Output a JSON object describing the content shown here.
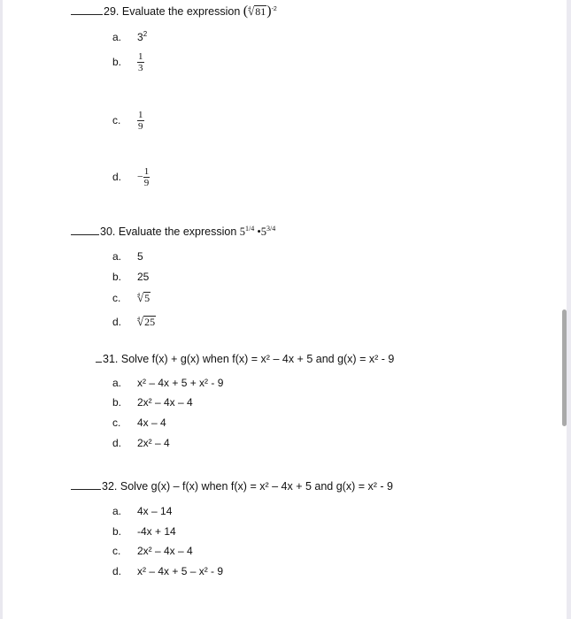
{
  "questions": [
    {
      "number": "29.",
      "prompt": "Evaluate the expression",
      "expression": {
        "root_index": "4",
        "radicand": "81",
        "exponent": "-2"
      },
      "choices": [
        {
          "letter": "a.",
          "base": "3",
          "exp": "2"
        },
        {
          "letter": "b.",
          "num": "1",
          "den": "3"
        },
        {
          "letter": "c.",
          "num": "1",
          "den": "9"
        },
        {
          "letter": "d.",
          "sign": "−",
          "num": "1",
          "den": "9"
        }
      ]
    },
    {
      "number": "30.",
      "prompt": "Evaluate the expression",
      "expression": {
        "base1": "5",
        "exp1": "1/4",
        "dot": "•",
        "base2": "5",
        "exp2": "3/4"
      },
      "choices": [
        {
          "letter": "a.",
          "text": "5"
        },
        {
          "letter": "b.",
          "text": "25"
        },
        {
          "letter": "c.",
          "root_index": "4",
          "radicand": "5"
        },
        {
          "letter": "d.",
          "root_index": "4",
          "radicand": "25"
        }
      ]
    },
    {
      "number": "31.",
      "prompt": "Solve  f(x) + g(x) when  f(x) = x² – 4x + 5 and g(x) = x² - 9",
      "choices": [
        {
          "letter": "a.",
          "text": "x² – 4x + 5 + x² - 9"
        },
        {
          "letter": "b.",
          "text": "2x² – 4x – 4"
        },
        {
          "letter": "c.",
          "text": "4x – 4"
        },
        {
          "letter": "d.",
          "text": "2x² – 4"
        }
      ]
    },
    {
      "number": "32.",
      "prompt": "Solve g(x) – f(x) when  f(x) = x² – 4x + 5 and g(x) = x² - 9",
      "choices": [
        {
          "letter": "a.",
          "text": "4x – 14"
        },
        {
          "letter": "b.",
          "text": "-4x + 14"
        },
        {
          "letter": "c.",
          "text": "2x² – 4x – 4"
        },
        {
          "letter": "d.",
          "text": "x² – 4x + 5 – x² - 9"
        }
      ]
    }
  ],
  "radical_symbol": "√",
  "open_paren": "(",
  "close_paren": ")"
}
